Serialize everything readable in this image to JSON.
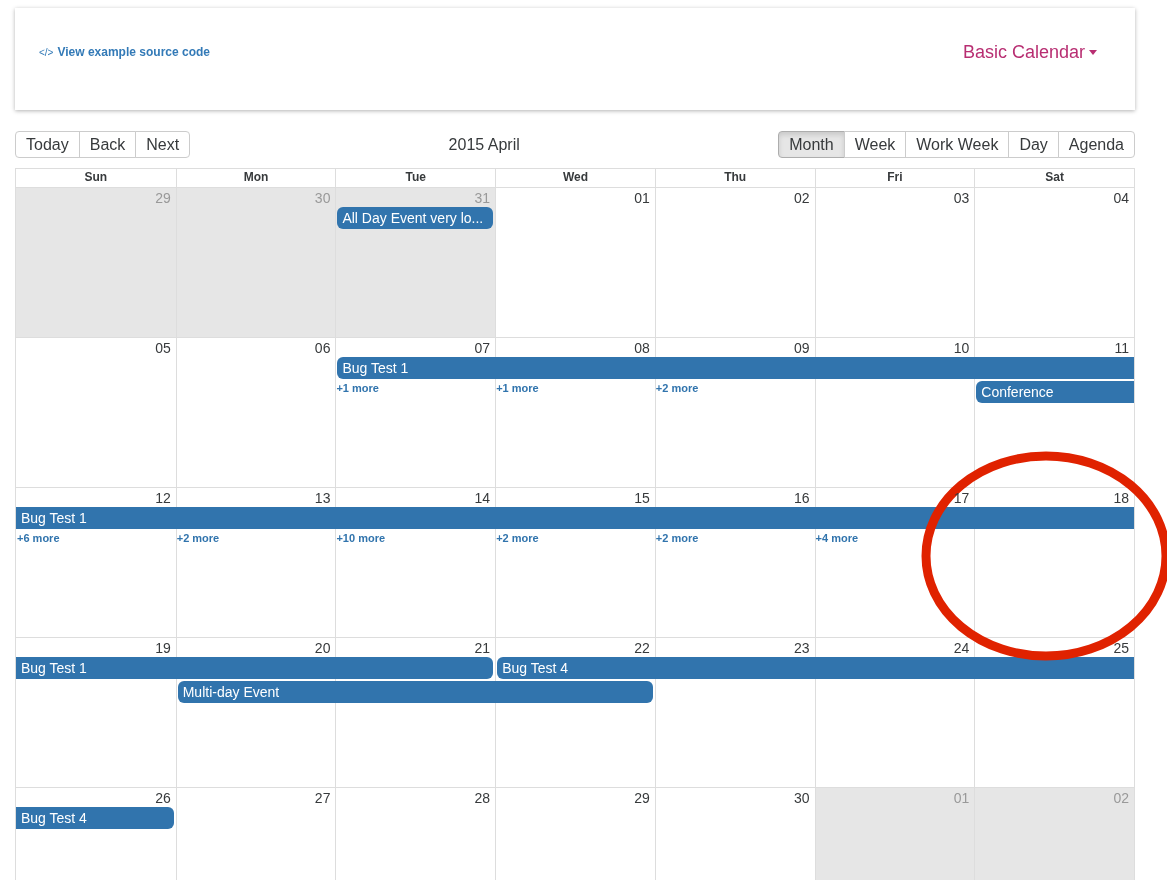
{
  "header": {
    "source_link": "View example source code",
    "source_icon": "</>",
    "example_menu": "Basic Calendar"
  },
  "toolbar": {
    "nav_buttons": [
      "Today",
      "Back",
      "Next"
    ],
    "title": "2015 April",
    "views": [
      {
        "label": "Month",
        "selected": true
      },
      {
        "label": "Week",
        "selected": false
      },
      {
        "label": "Work Week",
        "selected": false
      },
      {
        "label": "Day",
        "selected": false
      },
      {
        "label": "Agenda",
        "selected": false
      }
    ]
  },
  "weekdays": [
    "Sun",
    "Mon",
    "Tue",
    "Wed",
    "Thu",
    "Fri",
    "Sat"
  ],
  "weeks": [
    {
      "days": [
        {
          "label": "29",
          "off_range": true
        },
        {
          "label": "30",
          "off_range": true
        },
        {
          "label": "31",
          "off_range": true
        },
        {
          "label": "01",
          "off_range": false
        },
        {
          "label": "02",
          "off_range": false
        },
        {
          "label": "03",
          "off_range": false
        },
        {
          "label": "04",
          "off_range": false
        }
      ],
      "lanes": [
        [
          {
            "kind": "blank"
          },
          {
            "kind": "blank"
          },
          {
            "kind": "event",
            "title": "All Day Event very lo...",
            "continues_before": false,
            "continues_after": false
          },
          {
            "kind": "blank"
          },
          {
            "kind": "blank"
          },
          {
            "kind": "blank"
          },
          {
            "kind": "blank"
          }
        ]
      ]
    },
    {
      "days": [
        {
          "label": "05",
          "off_range": false
        },
        {
          "label": "06",
          "off_range": false
        },
        {
          "label": "07",
          "off_range": false,
          "more": "+1 more"
        },
        {
          "label": "08",
          "off_range": false,
          "more": "+1 more"
        },
        {
          "label": "09",
          "off_range": false,
          "more": "+2 more"
        },
        {
          "label": "10",
          "off_range": false
        },
        {
          "label": "11",
          "off_range": false
        }
      ],
      "lanes": [
        [
          {
            "kind": "blank"
          },
          {
            "kind": "blank"
          },
          {
            "kind": "event",
            "title": "Bug Test 1",
            "continues_before": false,
            "continues_after": true
          },
          {
            "kind": "extension"
          },
          {
            "kind": "extension"
          },
          {
            "kind": "extension"
          },
          {
            "kind": "extension"
          }
        ],
        [
          {
            "kind": "blank"
          },
          {
            "kind": "blank"
          },
          {
            "kind": "blank"
          },
          {
            "kind": "blank"
          },
          {
            "kind": "blank"
          },
          {
            "kind": "blank"
          },
          {
            "kind": "event",
            "title": "Conference",
            "continues_before": false,
            "continues_after": true
          }
        ]
      ]
    },
    {
      "days": [
        {
          "label": "12",
          "off_range": false,
          "more": "+6 more"
        },
        {
          "label": "13",
          "off_range": false,
          "more": "+2 more"
        },
        {
          "label": "14",
          "off_range": false,
          "more": "+10 more"
        },
        {
          "label": "15",
          "off_range": false,
          "more": "+2 more"
        },
        {
          "label": "16",
          "off_range": false,
          "more": "+2 more"
        },
        {
          "label": "17",
          "off_range": false,
          "more": "+4 more"
        },
        {
          "label": "18",
          "off_range": false
        }
      ],
      "lanes": [
        [
          {
            "kind": "event",
            "title": "Bug Test 1",
            "continues_before": true,
            "continues_after": true
          },
          {
            "kind": "extension"
          },
          {
            "kind": "extension"
          },
          {
            "kind": "extension"
          },
          {
            "kind": "extension"
          },
          {
            "kind": "extension"
          },
          {
            "kind": "extension"
          }
        ]
      ]
    },
    {
      "days": [
        {
          "label": "19",
          "off_range": false
        },
        {
          "label": "20",
          "off_range": false
        },
        {
          "label": "21",
          "off_range": false
        },
        {
          "label": "22",
          "off_range": false
        },
        {
          "label": "23",
          "off_range": false
        },
        {
          "label": "24",
          "off_range": false
        },
        {
          "label": "25",
          "off_range": false
        }
      ],
      "lanes": [
        [
          {
            "kind": "event",
            "title": "Bug Test 1",
            "continues_before": true,
            "continues_after": false
          },
          {
            "kind": "extension"
          },
          {
            "kind": "extension"
          },
          {
            "kind": "event",
            "title": "Bug Test 4",
            "continues_before": false,
            "continues_after": true
          },
          {
            "kind": "extension"
          },
          {
            "kind": "extension"
          },
          {
            "kind": "extension"
          }
        ],
        [
          {
            "kind": "blank"
          },
          {
            "kind": "event",
            "title": "Multi-day Event",
            "continues_before": false,
            "continues_after": false
          },
          {
            "kind": "extension"
          },
          {
            "kind": "extension"
          },
          {
            "kind": "blank"
          },
          {
            "kind": "blank"
          },
          {
            "kind": "blank"
          }
        ]
      ]
    },
    {
      "days": [
        {
          "label": "26",
          "off_range": false
        },
        {
          "label": "27",
          "off_range": false
        },
        {
          "label": "28",
          "off_range": false
        },
        {
          "label": "29",
          "off_range": false
        },
        {
          "label": "30",
          "off_range": false
        },
        {
          "label": "01",
          "off_range": true
        },
        {
          "label": "02",
          "off_range": true
        }
      ],
      "lanes": [
        [
          {
            "kind": "event",
            "title": "Bug Test 4",
            "continues_before": true,
            "continues_after": false
          },
          {
            "kind": "blank"
          },
          {
            "kind": "blank"
          },
          {
            "kind": "blank"
          },
          {
            "kind": "blank"
          },
          {
            "kind": "blank"
          },
          {
            "kind": "blank"
          }
        ]
      ]
    }
  ],
  "annotation": {
    "kind": "ellipse"
  }
}
